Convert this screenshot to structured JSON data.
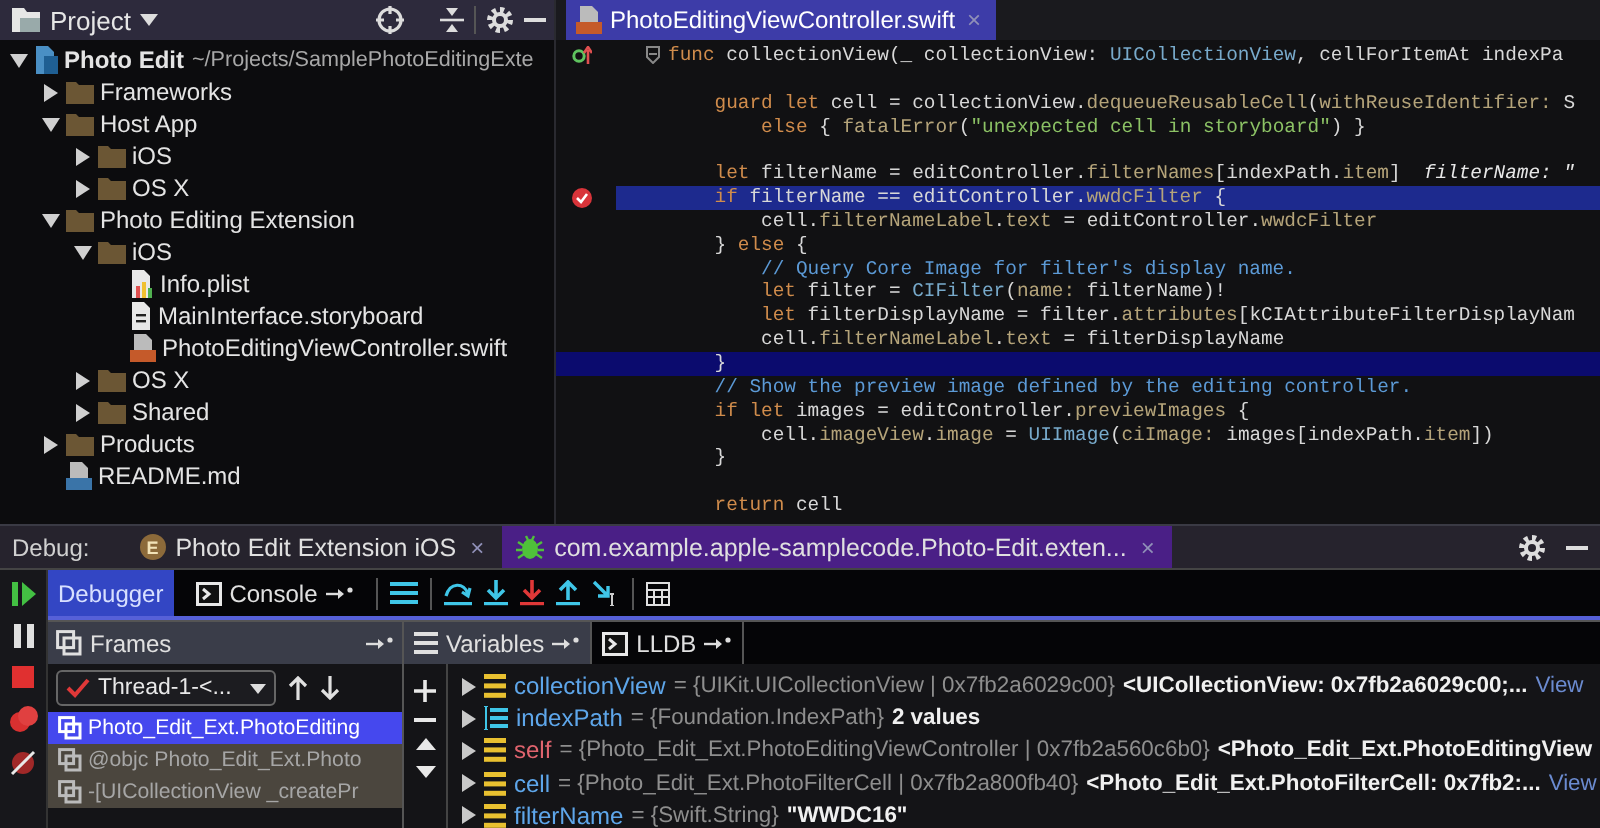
{
  "project_panel": {
    "title": "Project",
    "tree": [
      {
        "label": "Photo Edit",
        "path": "~/Projects/SamplePhotoEditingExte",
        "kind": "project",
        "expanded": true,
        "children": [
          {
            "label": "Frameworks",
            "kind": "folder",
            "expanded": false
          },
          {
            "label": "Host App",
            "kind": "folder",
            "expanded": true,
            "children": [
              {
                "label": "iOS",
                "kind": "folder",
                "expanded": false
              },
              {
                "label": "OS X",
                "kind": "folder",
                "expanded": false
              }
            ]
          },
          {
            "label": "Photo Editing Extension",
            "kind": "folder",
            "expanded": true,
            "children": [
              {
                "label": "iOS",
                "kind": "folder",
                "expanded": true,
                "children": [
                  {
                    "label": "Info.plist",
                    "kind": "plist"
                  },
                  {
                    "label": "MainInterface.storyboard",
                    "kind": "storyboard"
                  },
                  {
                    "label": "PhotoEditingViewController.swift",
                    "kind": "swift"
                  }
                ]
              },
              {
                "label": "OS X",
                "kind": "folder",
                "expanded": false
              },
              {
                "label": "Shared",
                "kind": "folder",
                "expanded": false
              }
            ]
          },
          {
            "label": "Products",
            "kind": "folder",
            "expanded": false
          },
          {
            "label": "README.md",
            "kind": "markdown"
          }
        ]
      }
    ]
  },
  "editor": {
    "tabs": [
      {
        "label": "PhotoEditingViewController.swift",
        "close": "×",
        "selected": true
      }
    ],
    "lines": [
      {
        "kind": "code",
        "override": true,
        "segments": [
          {
            "kind": "kw",
            "text": "func"
          },
          {
            "kind": "pl",
            "text": " collectionView(_ collectionView: "
          },
          {
            "kind": "ty",
            "text": "UICollectionView"
          },
          {
            "kind": "pl",
            "text": ", cellForItemAt indexPa"
          }
        ]
      },
      {
        "kind": "blank"
      },
      {
        "kind": "code",
        "segments": [
          {
            "kind": "kw",
            "text": "    guard let"
          },
          {
            "kind": "pl",
            "text": " cell = collectionView."
          },
          {
            "kind": "pr",
            "text": "dequeueReusableCell"
          },
          {
            "kind": "pl",
            "text": "("
          },
          {
            "kind": "pr",
            "text": "withReuseIdentifier:"
          },
          {
            "kind": "pl",
            "text": " S"
          }
        ]
      },
      {
        "kind": "code",
        "segments": [
          {
            "kind": "kw",
            "text": "        else"
          },
          {
            "kind": "pl",
            "text": " { "
          },
          {
            "kind": "pr",
            "text": "fatalError"
          },
          {
            "kind": "pl",
            "text": "("
          },
          {
            "kind": "st",
            "text": "\"unexpected cell in storyboard\""
          },
          {
            "kind": "pl",
            "text": ") }"
          }
        ]
      },
      {
        "kind": "blank"
      },
      {
        "kind": "code",
        "segments": [
          {
            "kind": "kw",
            "text": "    let"
          },
          {
            "kind": "pl",
            "text": " filterName = editController."
          },
          {
            "kind": "pr",
            "text": "filterNames"
          },
          {
            "kind": "pl",
            "text": "[indexPath."
          },
          {
            "kind": "pr",
            "text": "item"
          },
          {
            "kind": "pl",
            "text": "]  "
          },
          {
            "kind": "hint",
            "text": "filterName: \""
          }
        ]
      },
      {
        "kind": "code",
        "breakpoint": true,
        "segments": [
          {
            "kind": "kw",
            "text": "    if"
          },
          {
            "kind": "pl",
            "text": " filterName == editController."
          },
          {
            "kind": "pr",
            "text": "wwdcFilter"
          },
          {
            "kind": "pl",
            "text": " {"
          }
        ]
      },
      {
        "kind": "code",
        "segments": [
          {
            "kind": "pl",
            "text": "        cell."
          },
          {
            "kind": "pr",
            "text": "filterNameLabel"
          },
          {
            "kind": "pl",
            "text": "."
          },
          {
            "kind": "pr",
            "text": "text"
          },
          {
            "kind": "pl",
            "text": " = editController."
          },
          {
            "kind": "pr",
            "text": "wwdcFilter"
          }
        ]
      },
      {
        "kind": "code",
        "segments": [
          {
            "kind": "pl",
            "text": "    } "
          },
          {
            "kind": "kw",
            "text": "else"
          },
          {
            "kind": "pl",
            "text": " {"
          }
        ]
      },
      {
        "kind": "code",
        "segments": [
          {
            "kind": "cm",
            "text": "        // Query Core Image for filter's display name."
          }
        ]
      },
      {
        "kind": "code",
        "segments": [
          {
            "kind": "kw",
            "text": "        let"
          },
          {
            "kind": "pl",
            "text": " filter = "
          },
          {
            "kind": "ty",
            "text": "CIFilter"
          },
          {
            "kind": "pl",
            "text": "("
          },
          {
            "kind": "pr",
            "text": "name:"
          },
          {
            "kind": "pl",
            "text": " filterName)!"
          }
        ]
      },
      {
        "kind": "code",
        "segments": [
          {
            "kind": "kw",
            "text": "        let"
          },
          {
            "kind": "pl",
            "text": " filterDisplayName = filter."
          },
          {
            "kind": "pr",
            "text": "attributes"
          },
          {
            "kind": "pl",
            "text": "[kCIAttributeFilterDisplayNam"
          }
        ]
      },
      {
        "kind": "code",
        "segments": [
          {
            "kind": "pl",
            "text": "        cell."
          },
          {
            "kind": "pr",
            "text": "filterNameLabel"
          },
          {
            "kind": "pl",
            "text": "."
          },
          {
            "kind": "pr",
            "text": "text"
          },
          {
            "kind": "pl",
            "text": " = filterDisplayName"
          }
        ]
      },
      {
        "kind": "code",
        "current": true,
        "segments": [
          {
            "kind": "pl",
            "text": "    }"
          }
        ]
      },
      {
        "kind": "code",
        "segments": [
          {
            "kind": "cm",
            "text": "    // Show the preview image defined by the editing controller."
          }
        ]
      },
      {
        "kind": "code",
        "segments": [
          {
            "kind": "kw",
            "text": "    if let"
          },
          {
            "kind": "pl",
            "text": " images = editController."
          },
          {
            "kind": "pr",
            "text": "previewImages"
          },
          {
            "kind": "pl",
            "text": " {"
          }
        ]
      },
      {
        "kind": "code",
        "segments": [
          {
            "kind": "pl",
            "text": "        cell."
          },
          {
            "kind": "pr",
            "text": "imageView"
          },
          {
            "kind": "pl",
            "text": "."
          },
          {
            "kind": "pr",
            "text": "image"
          },
          {
            "kind": "pl",
            "text": " = "
          },
          {
            "kind": "ty",
            "text": "UIImage"
          },
          {
            "kind": "pl",
            "text": "("
          },
          {
            "kind": "pr",
            "text": "ciImage:"
          },
          {
            "kind": "pl",
            "text": " images[indexPath."
          },
          {
            "kind": "pr",
            "text": "item"
          },
          {
            "kind": "pl",
            "text": "])"
          }
        ]
      },
      {
        "kind": "code",
        "segments": [
          {
            "kind": "pl",
            "text": "    }"
          }
        ]
      },
      {
        "kind": "blank"
      },
      {
        "kind": "code",
        "segments": [
          {
            "kind": "kw",
            "text": "    return"
          },
          {
            "kind": "pl",
            "text": " cell"
          }
        ]
      }
    ]
  },
  "debug": {
    "label": "Debug:",
    "tabs": [
      {
        "label": "Photo Edit Extension iOS",
        "kind": "app",
        "badge": "E",
        "close": "×",
        "selected": false
      },
      {
        "label": "com.example.apple-samplecode.Photo-Edit.exten...",
        "kind": "bug",
        "close": "×",
        "selected": true
      }
    ],
    "tool_tabs": [
      {
        "label": "Debugger",
        "kind": "plain",
        "selected": true
      },
      {
        "label": "Console",
        "kind": "console",
        "selected": false
      }
    ],
    "frames": {
      "title": "Frames",
      "thread": "Thread-1-<...",
      "items": [
        {
          "label": "Photo_Edit_Ext.PhotoEditing",
          "selected": true
        },
        {
          "label": "@objc Photo_Edit_Ext.Photo",
          "selected": false
        },
        {
          "label": "-[UICollectionView _createPr",
          "selected": false
        }
      ]
    },
    "variables": {
      "tabs": [
        {
          "label": "Variables",
          "kind": "list",
          "selected": true
        },
        {
          "label": "LLDB",
          "kind": "console",
          "selected": false
        }
      ],
      "items": [
        {
          "name": "collectionView",
          "color": "#5ea6ea",
          "kind": "object",
          "type_text": "= {UIKit.UICollectionView | 0x7fb2a6029c00}",
          "value": "<UICollectionView: 0x7fb2a6029c00;...",
          "link": "View"
        },
        {
          "name": "indexPath",
          "color": "#5ea6ea",
          "kind": "array",
          "type_text": "= {Foundation.IndexPath}",
          "value": "2 values"
        },
        {
          "name": "self",
          "color": "#e0646e",
          "kind": "object",
          "type_text": "= {Photo_Edit_Ext.PhotoEditingViewController | 0x7fb2a560c6b0}",
          "value": "<Photo_Edit_Ext.PhotoEditingView"
        },
        {
          "name": "cell",
          "color": "#5ea6ea",
          "kind": "object",
          "type_text": "= {Photo_Edit_Ext.PhotoFilterCell | 0x7fb2a800fb40}",
          "value": "<Photo_Edit_Ext.PhotoFilterCell: 0x7fb2:...",
          "link": "View"
        },
        {
          "name": "filterName",
          "color": "#5ea6ea",
          "kind": "object",
          "type_text": "= {Swift.String}",
          "value": "\"WWDC16\""
        }
      ]
    }
  }
}
